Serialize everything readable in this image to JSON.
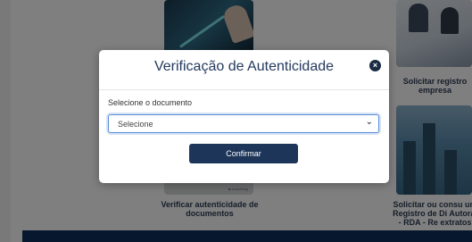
{
  "background": {
    "cards": [
      {
        "caption": "Verificar autenticidade de documentos",
        "image_tag": "■ something"
      },
      {
        "caption": "Solicitar registro empresa"
      },
      {
        "caption": "Solicitar ou consu um Registro de Di Autoral - RDA - Re extratos"
      }
    ]
  },
  "modal": {
    "title": "Verificação de Autenticidade",
    "close_icon": "×",
    "field_label": "Selecione o documento",
    "select": {
      "selected": "Selecione",
      "chevron": "⌄"
    },
    "confirm_label": "Confirmar"
  },
  "colors": {
    "primary": "#1c3559",
    "title": "#243a5e",
    "overlay": "rgba(0,0,0,0.5)",
    "focus_border": "#5b8fd6"
  }
}
